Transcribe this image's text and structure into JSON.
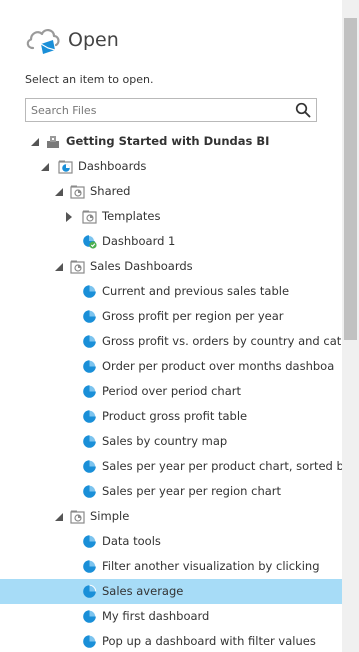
{
  "dialog": {
    "title": "Open",
    "instruction": "Select an item to open."
  },
  "search": {
    "placeholder": "Search Files"
  },
  "colors": {
    "accent": "#1a8fd8",
    "selection": "#a7dcf7",
    "check": "#4caf50"
  },
  "tree": [
    {
      "label": "Getting Started with Dundas BI",
      "bold": true,
      "level": 0,
      "icon": "project-icon",
      "expander": "expanded"
    },
    {
      "label": "Dashboards",
      "level": 1,
      "icon": "dashboards-folder-icon",
      "expander": "expanded"
    },
    {
      "label": "Shared",
      "level": 2,
      "icon": "folder-icon",
      "expander": "expanded"
    },
    {
      "label": "Templates",
      "level": 3,
      "icon": "folder-icon",
      "expander": "collapsed"
    },
    {
      "label": "Dashboard 1",
      "level": 3,
      "icon": "dashboard-checked-icon",
      "expander": "none"
    },
    {
      "label": "Sales Dashboards",
      "level": 2,
      "icon": "folder-icon",
      "expander": "expanded"
    },
    {
      "label": "Current and previous sales table",
      "level": 3,
      "icon": "dashboard-icon",
      "expander": "none"
    },
    {
      "label": "Gross profit per region per year",
      "level": 3,
      "icon": "dashboard-icon",
      "expander": "none"
    },
    {
      "label": "Gross profit vs. orders by country and cat",
      "level": 3,
      "icon": "dashboard-icon",
      "expander": "none"
    },
    {
      "label": "Order per product over months dashboa",
      "level": 3,
      "icon": "dashboard-icon",
      "expander": "none"
    },
    {
      "label": "Period over period chart",
      "level": 3,
      "icon": "dashboard-icon",
      "expander": "none"
    },
    {
      "label": "Product gross profit table",
      "level": 3,
      "icon": "dashboard-icon",
      "expander": "none"
    },
    {
      "label": "Sales by country map",
      "level": 3,
      "icon": "dashboard-icon",
      "expander": "none"
    },
    {
      "label": "Sales per year per product chart, sorted b",
      "level": 3,
      "icon": "dashboard-icon",
      "expander": "none"
    },
    {
      "label": "Sales per year per region chart",
      "level": 3,
      "icon": "dashboard-icon",
      "expander": "none"
    },
    {
      "label": "Simple",
      "level": 2,
      "icon": "folder-icon",
      "expander": "expanded"
    },
    {
      "label": "Data tools",
      "level": 3,
      "icon": "dashboard-icon",
      "expander": "none"
    },
    {
      "label": "Filter another visualization by clicking",
      "level": 3,
      "icon": "dashboard-icon",
      "expander": "none"
    },
    {
      "label": "Sales average",
      "level": 3,
      "icon": "dashboard-icon",
      "expander": "none",
      "selected": true
    },
    {
      "label": "My first dashboard",
      "level": 3,
      "icon": "dashboard-icon",
      "expander": "none"
    },
    {
      "label": "Pop up a dashboard with filter values",
      "level": 3,
      "icon": "dashboard-icon",
      "expander": "none"
    }
  ]
}
